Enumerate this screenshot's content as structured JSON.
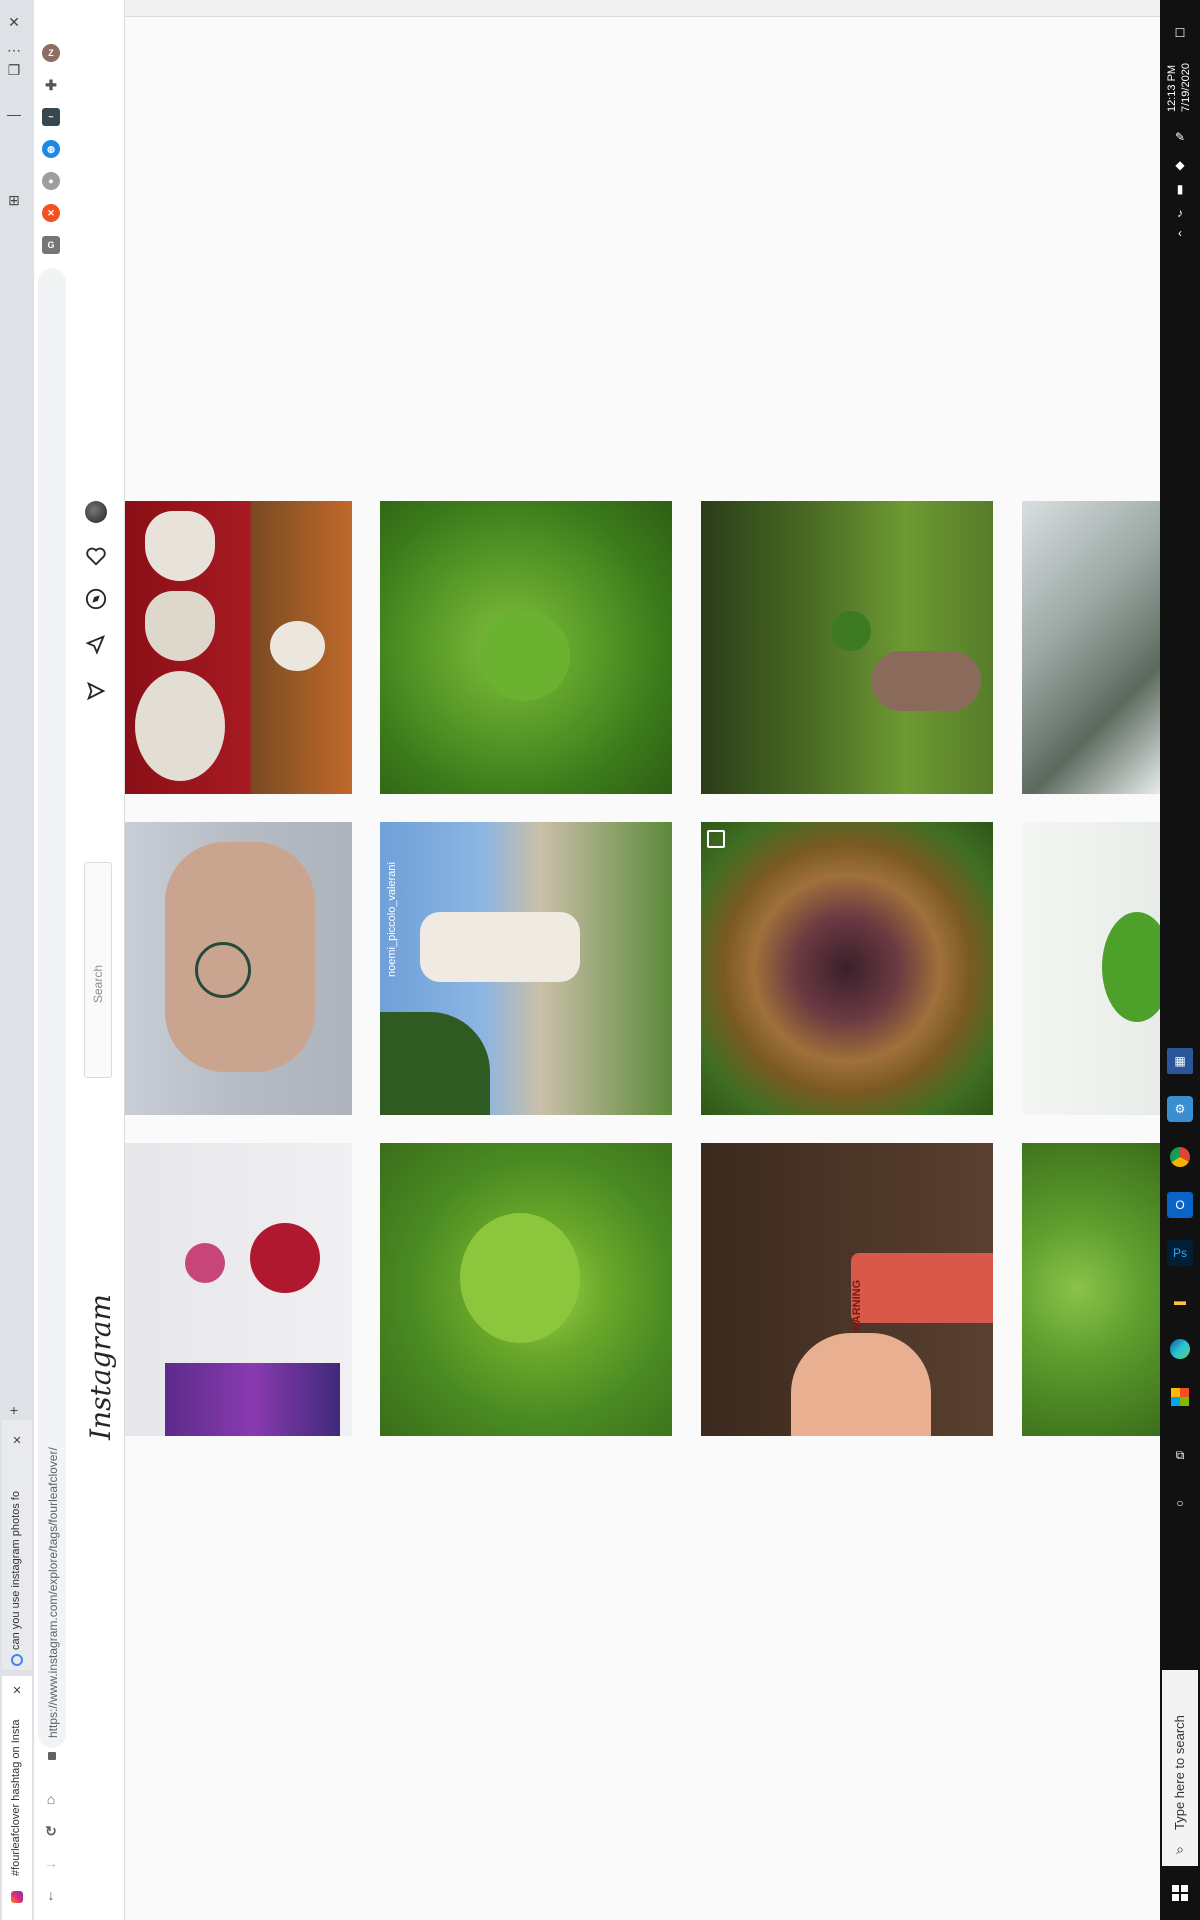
{
  "browser": {
    "tabs": [
      {
        "title": "#fourleafclover hashtag on Insta"
      },
      {
        "title": "can you use instagram photos fo"
      }
    ],
    "url": "https://www.instagram.com/explore/tags/fourleafclover/",
    "profile_initial": "Z"
  },
  "instagram": {
    "logo": "Instagram",
    "search_placeholder": "Search",
    "posts": [
      {
        "alt": "heart lockets",
        "overlay": ""
      },
      {
        "alt": "clover patch",
        "overlay": ""
      },
      {
        "alt": "hand holding clover over field",
        "overlay": ""
      },
      {
        "alt": "white altar with plants",
        "overlay": ""
      },
      {
        "alt": "clover tattoo",
        "overlay": ""
      },
      {
        "alt": "woman in white dress",
        "overlay": "noemi_piccolo_valerani"
      },
      {
        "alt": "basket of berries",
        "overlay": ""
      },
      {
        "alt": "clover on white",
        "overlay": ""
      },
      {
        "alt": "pressed flowers",
        "overlay": ""
      },
      {
        "alt": "four leaf clover in grass",
        "overlay": ""
      },
      {
        "alt": "firecracker in hand",
        "overlay": "WARNING"
      },
      {
        "alt": "leafy greens",
        "overlay": ""
      }
    ]
  },
  "taskbar": {
    "search_placeholder": "Type here to search",
    "time": "12:13 PM",
    "date": "7/19/2020"
  },
  "colors": {
    "taskbar": "#111111",
    "accent": "#0078d7",
    "instagram_bg": "#fafafa"
  }
}
